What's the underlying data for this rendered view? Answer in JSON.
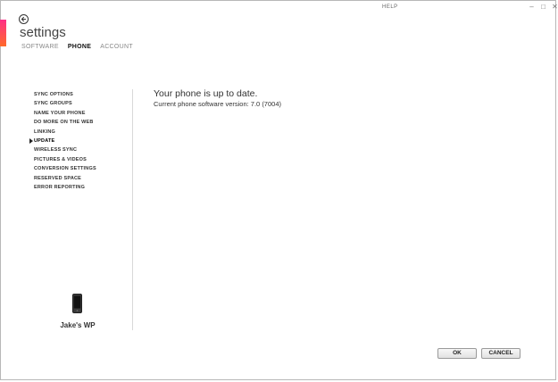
{
  "window": {
    "help_label": "HELP",
    "controls": [
      "‒",
      "□",
      "✕"
    ]
  },
  "header": {
    "title": "settings",
    "tabs": [
      {
        "label": "SOFTWARE",
        "active": false
      },
      {
        "label": "PHONE",
        "active": true
      },
      {
        "label": "ACCOUNT",
        "active": false
      }
    ]
  },
  "sidebar": {
    "items": [
      {
        "label": "SYNC OPTIONS"
      },
      {
        "label": "SYNC GROUPS"
      },
      {
        "label": "NAME YOUR PHONE"
      },
      {
        "label": "DO MORE ON THE WEB"
      },
      {
        "label": "LINKING"
      },
      {
        "label": "UPDATE",
        "selected": true
      },
      {
        "label": "WIRELESS SYNC"
      },
      {
        "label": "PICTURES & VIDEOS"
      },
      {
        "label": "CONVERSION SETTINGS"
      },
      {
        "label": "RESERVED SPACE"
      },
      {
        "label": "ERROR REPORTING"
      }
    ],
    "device_name": "Jake's WP"
  },
  "main": {
    "status_heading": "Your phone is up to date.",
    "version_text": "Current phone software version: 7.0 (7004)"
  },
  "footer": {
    "ok_label": "OK",
    "cancel_label": "CANCEL"
  },
  "colors": {
    "accent_top": "#ff2f87",
    "accent_bottom": "#ff6a2a"
  },
  "icons": {
    "back": "back-arrow-icon",
    "phone": "phone-icon"
  }
}
